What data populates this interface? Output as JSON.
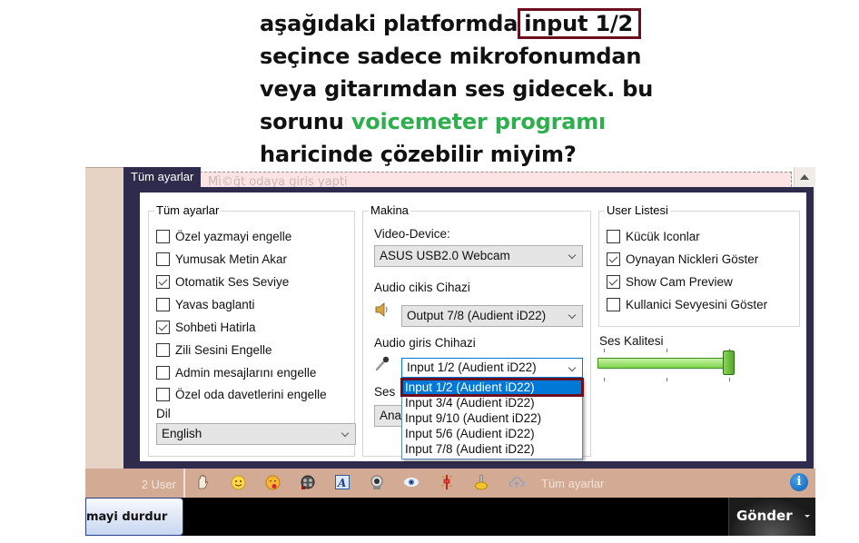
{
  "caption": {
    "line1_before": "aşağıdaki platformda",
    "line1_highlight": "input 1/2",
    "line2": "seçince sadece mikrofonumdan",
    "line3": "veya gitarımdan ses gidecek. bu",
    "line4_before": "sorunu ",
    "line4_green": "voicemeter programı",
    "line5": "haricinde çözebilir miyim?"
  },
  "colors": {
    "highlight_border": "#6b0f1e",
    "green_text": "#2fae4e",
    "dialog_frame": "#2e2b4c",
    "selected_option": "#0078d7",
    "toolbar_bg": "#d3ab95"
  },
  "chat_input": {
    "placeholder_garbled": "Mı̀©ğt odaya giris yapti"
  },
  "dialog": {
    "tab_title": "Tüm ayarlar",
    "general": {
      "title": "Tüm ayarlar",
      "checkboxes": [
        {
          "label": "Özel yazmayi engelle",
          "checked": false
        },
        {
          "label": "Yumusak Metin Akar",
          "checked": false
        },
        {
          "label": "Otomatik Ses Seviye",
          "checked": true
        },
        {
          "label": "Yavas baglanti",
          "checked": false
        },
        {
          "label": "Sohbeti Hatirla",
          "checked": true
        },
        {
          "label": "Zili Sesini Engelle",
          "checked": false
        },
        {
          "label": "Admin mesajlarını engelle",
          "checked": false
        },
        {
          "label": "Özel oda davetlerini engelle",
          "checked": false
        }
      ],
      "language_label": "Dil",
      "language_value": "English"
    },
    "machine": {
      "title": "Makina",
      "video_label": "Video-Device:",
      "video_value": "ASUS USB2.0 Webcam",
      "audio_out_label": "Audio cikis Cihazi",
      "audio_out_value": "Output 7/8 (Audient iD22)",
      "audio_in_label": "Audio giris Chihazi",
      "audio_in_value": "Input 1/2 (Audient iD22)",
      "audio_in_options": [
        "Input 1/2 (Audient iD22)",
        "Input 3/4 (Audient iD22)",
        "Input 9/10 (Audient iD22)",
        "Input 5/6 (Audient iD22)",
        "Input 7/8 (Audient iD22)"
      ],
      "audio_in_selected_index": 0,
      "hidden_label_partial": "Ses",
      "hidden_select_partial": "Ana"
    },
    "user_list": {
      "title": "User Listesi",
      "checkboxes": [
        {
          "label": "Kücük Iconlar",
          "checked": false
        },
        {
          "label": "Oynayan Nickleri Göster",
          "checked": true
        },
        {
          "label": "Show Cam Preview",
          "checked": true
        },
        {
          "label": "Kullanici Sevyesini Göster",
          "checked": false
        }
      ]
    },
    "sound_quality": {
      "label": "Ses Kalitesi",
      "value_fraction": 1.0
    }
  },
  "toolbar": {
    "user_count": "2 User",
    "icons": [
      "hand-icon",
      "smiley-icon",
      "tongue-emoji-icon",
      "film-reel-icon",
      "font-icon",
      "webcam-icon",
      "eye-icon",
      "equalizer-icon",
      "joystick-icon",
      "cloud-upload-icon"
    ],
    "settings_label": "Tüm ayarlar",
    "info_glyph": "i"
  },
  "bottom": {
    "stop_button": "mayi durdur",
    "send_button": "Gönder"
  }
}
